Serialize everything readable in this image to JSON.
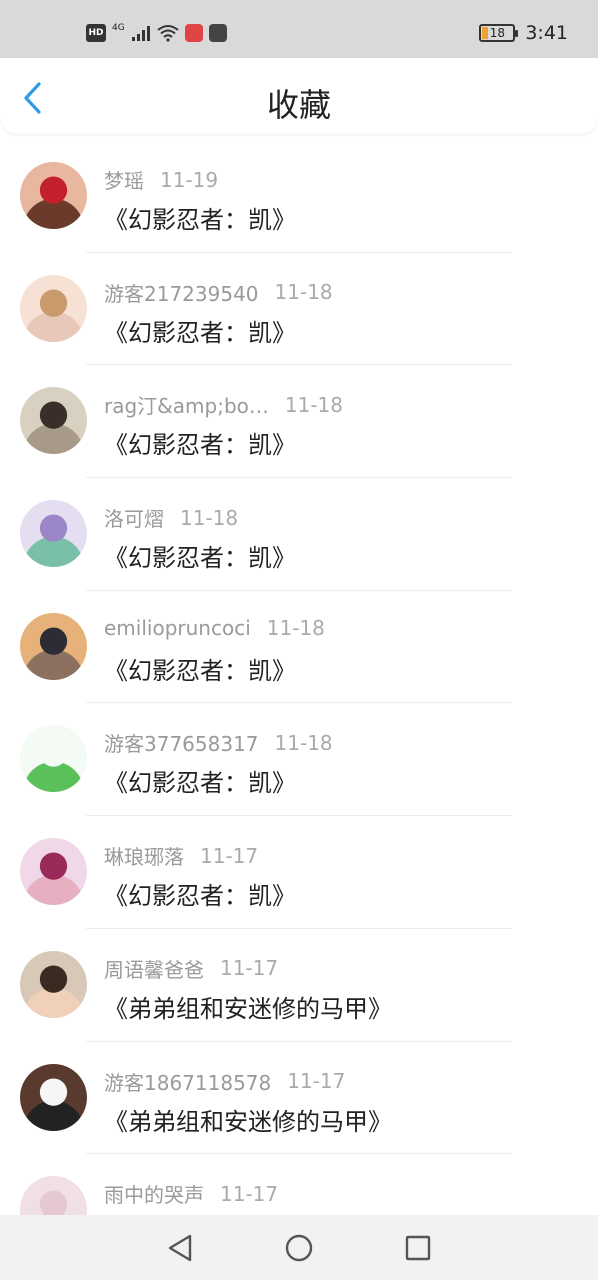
{
  "status_bar": {
    "hd": "HD",
    "network": "4G",
    "battery": "18",
    "time": "3:41",
    "app_icon_colors": [
      "#e04545",
      "#444444"
    ]
  },
  "header": {
    "title": "收藏",
    "back_icon": "chevron-left-icon",
    "accent": "#2f9be6"
  },
  "items": [
    {
      "user": "梦瑶",
      "date": "11-19",
      "title": "《幻影忍者：凯》",
      "avatar": [
        "#e9b6a0",
        "#c2202a",
        "#6a3a2a"
      ]
    },
    {
      "user": "游客217239540",
      "date": "11-18",
      "title": "《幻影忍者：凯》",
      "avatar": [
        "#f6e1d4",
        "#c89a6c",
        "#e8c8b8"
      ]
    },
    {
      "user": "rag汀&amp;bo…",
      "date": "11-18",
      "title": "《幻影忍者：凯》",
      "avatar": [
        "#d8d0c0",
        "#3a2e28",
        "#a89a88"
      ]
    },
    {
      "user": "洛可熠",
      "date": "11-18",
      "title": "《幻影忍者：凯》",
      "avatar": [
        "#e4def0",
        "#9b86c8",
        "#7ac0a8"
      ]
    },
    {
      "user": "emiliopruncoci",
      "date": "11-18",
      "title": "《幻影忍者：凯》",
      "avatar": [
        "#e6b27a",
        "#2c2c34",
        "#8c7060"
      ]
    },
    {
      "user": "游客377658317",
      "date": "11-18",
      "title": "《幻影忍者：凯》",
      "avatar": [
        "#f4faf4",
        "#f4faf4",
        "#5ac05a"
      ]
    },
    {
      "user": "琳琅琊落",
      "date": "11-17",
      "title": "《幻影忍者：凯》",
      "avatar": [
        "#f0d8e8",
        "#9a2a5a",
        "#e6b0c0"
      ]
    },
    {
      "user": "周语馨爸爸",
      "date": "11-17",
      "title": "《弟弟组和安迷修的马甲》",
      "avatar": [
        "#d8c8b8",
        "#3a2a22",
        "#f0d0b8"
      ]
    },
    {
      "user": "游客1867118578",
      "date": "11-17",
      "title": "《弟弟组和安迷修的马甲》",
      "avatar": [
        "#5a3a2e",
        "#f6f6f6",
        "#222222"
      ]
    },
    {
      "user": "雨中的哭声",
      "date": "11-17",
      "title": "",
      "avatar": [
        "#f0e0e6",
        "#e6c8d4",
        "#d8b8c8"
      ]
    }
  ],
  "nav": {
    "back": "nav-back-icon",
    "home": "nav-home-icon",
    "recents": "nav-recents-icon"
  }
}
